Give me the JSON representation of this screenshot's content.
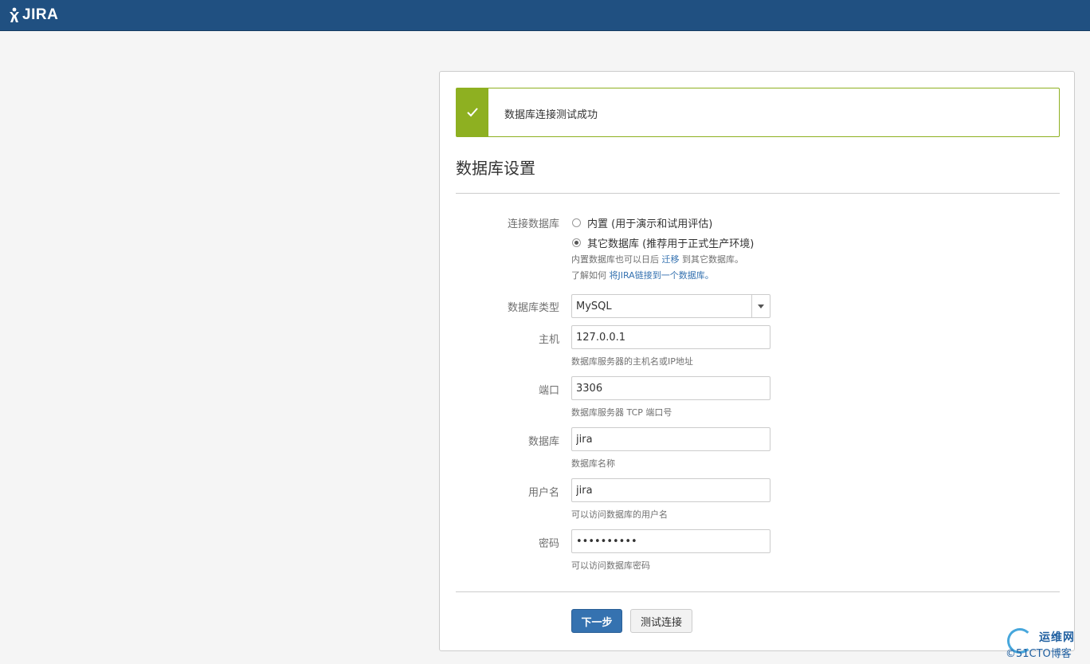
{
  "header": {
    "logo_text": "JIRA"
  },
  "banner": {
    "message": "数据库连接测试成功"
  },
  "page_title": "数据库设置",
  "connection": {
    "label": "连接数据库",
    "options": [
      {
        "text": "内置 (用于演示和试用评估)",
        "checked": false
      },
      {
        "text": "其它数据库 (推荐用于正式生产环境)",
        "checked": true
      }
    ],
    "hint1_prefix": "内置数据库也可以日后",
    "hint1_link": "迁移",
    "hint1_suffix": "到其它数据库。",
    "hint2_prefix": "了解如何",
    "hint2_link": "将JIRA链接到一个数据库。"
  },
  "db_type": {
    "label": "数据库类型",
    "value": "MySQL"
  },
  "host": {
    "label": "主机",
    "value": "127.0.0.1",
    "hint": "数据库服务器的主机名或IP地址"
  },
  "port": {
    "label": "端口",
    "value": "3306",
    "hint": "数据库服务器 TCP 端口号"
  },
  "database": {
    "label": "数据库",
    "value": "jira",
    "hint": "数据库名称"
  },
  "username": {
    "label": "用户名",
    "value": "jira",
    "hint": "可以访问数据库的用户名"
  },
  "password": {
    "label": "密码",
    "value": "••••••••••",
    "hint": "可以访问数据库密码"
  },
  "buttons": {
    "next": "下一步",
    "test": "测试连接"
  },
  "watermark": {
    "line1": "运维网",
    "line2": "©51CTO博客"
  },
  "colors": {
    "header": "#205081",
    "success": "#8eb021",
    "primary": "#3572b0",
    "link": "#3572b0"
  }
}
